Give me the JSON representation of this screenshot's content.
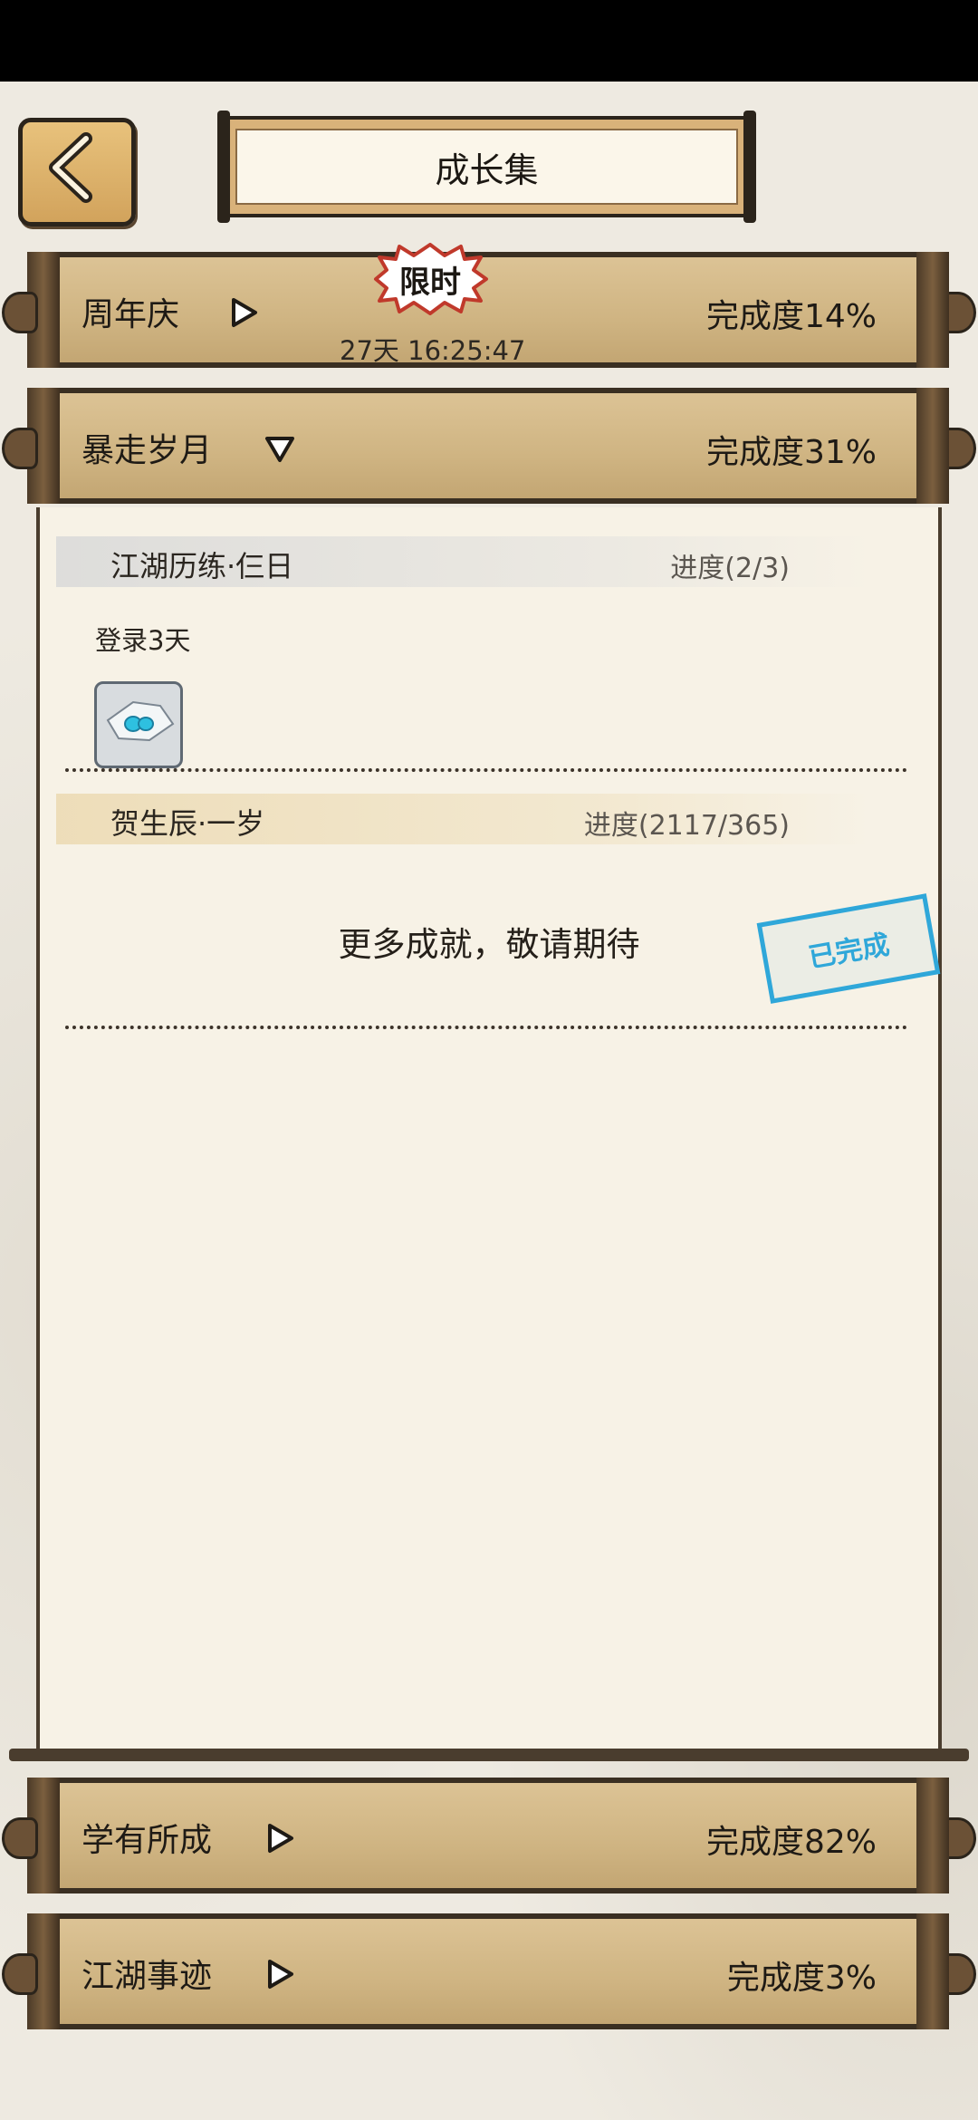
{
  "header": {
    "title": "成长集"
  },
  "categories": [
    {
      "title": "周年庆",
      "progress": "完成度14%",
      "badge": "限时",
      "countdown": "27天 16:25:47",
      "expanded": false
    },
    {
      "title": "暴走岁月",
      "progress": "完成度31%",
      "expanded": true,
      "achievements": [
        {
          "name": "江湖历练·仨日",
          "progress": "进度(2/3)",
          "description": "登录3天",
          "reward_icon": "gem-envelope-icon"
        },
        {
          "name": "贺生辰·一岁",
          "progress": "进度(2117/365)",
          "status_stamp": "已完成"
        }
      ],
      "more_text": "更多成就，敬请期待"
    },
    {
      "title": "学有所成",
      "progress": "完成度82%",
      "expanded": false
    },
    {
      "title": "江湖事迹",
      "progress": "完成度3%",
      "expanded": false
    }
  ],
  "colors": {
    "parchment": "#f7f2e6",
    "bar_gold": "#cfb482",
    "frame_dark": "#3a2f22",
    "stamp_blue": "#2fa7d9"
  }
}
